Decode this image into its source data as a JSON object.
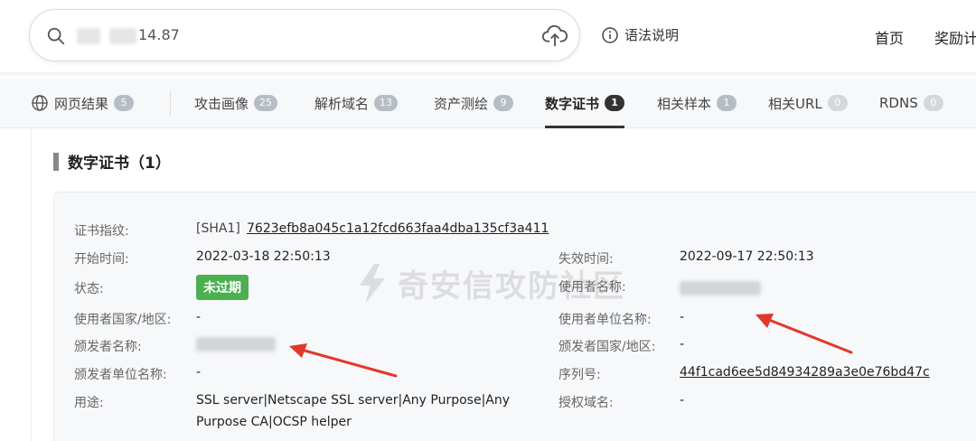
{
  "search": {
    "query": "14.87",
    "upload_icon": "cloud-upload-icon",
    "search_icon": "search-icon"
  },
  "header": {
    "syntax_label": "语法说明",
    "home_label": "首页",
    "reward_label": "奖励计"
  },
  "tabs": [
    {
      "label": "网页结果",
      "count": "5"
    },
    {
      "label": "攻击画像",
      "count": "25"
    },
    {
      "label": "解析域名",
      "count": "13"
    },
    {
      "label": "资产测绘",
      "count": "9"
    },
    {
      "label": "数字证书",
      "count": "1"
    },
    {
      "label": "相关样本",
      "count": "1"
    },
    {
      "label": "相关URL",
      "count": "0"
    },
    {
      "label": "RDNS",
      "count": "0"
    }
  ],
  "section": {
    "title": "数字证书（1）"
  },
  "watermark": {
    "text": "奇安信攻防社区"
  },
  "cert": {
    "fingerprint_label": "证书指纹:",
    "fingerprint_prefix": "[SHA1]",
    "fingerprint_value": "7623efb8a045c1a12fcd663faa4dba135cf3a411",
    "start_label": "开始时间:",
    "start_value": "2022-03-18 22:50:13",
    "expire_label": "失效时间:",
    "expire_value": "2022-09-17 22:50:13",
    "status_label": "状态:",
    "status_value": "未过期",
    "user_name_label": "使用者名称:",
    "user_country_label": "使用者国家/地区:",
    "user_country_value": "-",
    "user_org_label": "使用者单位名称:",
    "user_org_value": "-",
    "issuer_name_label": "颁发者名称:",
    "issuer_country_label": "颁发者国家/地区:",
    "issuer_country_value": "-",
    "issuer_org_label": "颁发者单位名称:",
    "issuer_org_value": "-",
    "serial_label": "序列号:",
    "serial_value": "44f1cad6ee5d84934289a3e0e76bd47c",
    "usage_label": "用途:",
    "usage_value_line1": "SSL server|Netscape SSL server|Any Purpose|Any",
    "usage_value_line2": "Purpose CA|OCSP helper",
    "auth_domain_label": "授权域名:",
    "auth_domain_value": "-"
  },
  "colors": {
    "status_green": "#4caf50",
    "annotation_red": "#e0392b",
    "active_tab": "#333333"
  }
}
